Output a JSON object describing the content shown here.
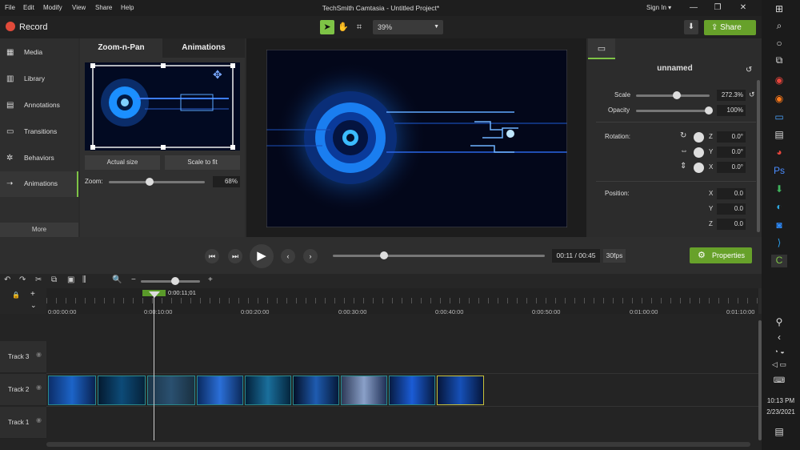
{
  "menu": {
    "items": [
      "File",
      "Edit",
      "Modify",
      "View",
      "Share",
      "Help"
    ],
    "title": "TechSmith Camtasia - Untitled Project*",
    "signin": "Sign In ▾"
  },
  "toolbar": {
    "record_label": "Record",
    "zoom_value": "39%",
    "share_label": "Share"
  },
  "sidebar": {
    "items": [
      {
        "label": "Media",
        "icon": "media-icon"
      },
      {
        "label": "Library",
        "icon": "library-icon"
      },
      {
        "label": "Annotations",
        "icon": "annotations-icon"
      },
      {
        "label": "Transitions",
        "icon": "transitions-icon"
      },
      {
        "label": "Behaviors",
        "icon": "behaviors-icon"
      },
      {
        "label": "Animations",
        "icon": "animations-icon"
      }
    ],
    "more_label": "More"
  },
  "panel": {
    "tabs": [
      "Zoom-n-Pan",
      "Animations"
    ],
    "actual_size": "Actual size",
    "scale_to_fit": "Scale to fit",
    "zoom_label": "Zoom:",
    "zoom_value": "68%",
    "zoom_level": 0.68
  },
  "properties": {
    "clip_name": "unnamed",
    "scale_label": "Scale",
    "scale_value": "272.3%",
    "opacity_label": "Opacity",
    "opacity_value": "100%",
    "rotation_label": "Rotation:",
    "rot": [
      {
        "axis": "Z",
        "value": "0.0°"
      },
      {
        "axis": "Y",
        "value": "0.0°"
      },
      {
        "axis": "X",
        "value": "0.0°"
      }
    ],
    "position_label": "Position:",
    "pos": [
      {
        "axis": "X",
        "value": "0.0"
      },
      {
        "axis": "Y",
        "value": "0.0"
      },
      {
        "axis": "Z",
        "value": "0.0"
      }
    ]
  },
  "playback": {
    "timecode": "00:11 / 00:45",
    "fps": "30fps",
    "properties_label": "Properties",
    "progress": 0.24
  },
  "timeline": {
    "playhead": "0:00:11;01",
    "ticks": [
      "0:00:00;00",
      "0:00:10;00",
      "0:00:20;00",
      "0:00:30;00",
      "0:00:40;00",
      "0:00:50;00",
      "0:01:00;00",
      "0:01:10;00"
    ],
    "tracks": [
      "Track 3",
      "Track 2",
      "Track 1"
    ]
  },
  "taskbar": {
    "time": "10:13 PM",
    "date": "2/23/2021"
  },
  "colors": {
    "accent": "#67a12a",
    "clip_border": "#2a8a8c",
    "record": "#e04a3a"
  }
}
